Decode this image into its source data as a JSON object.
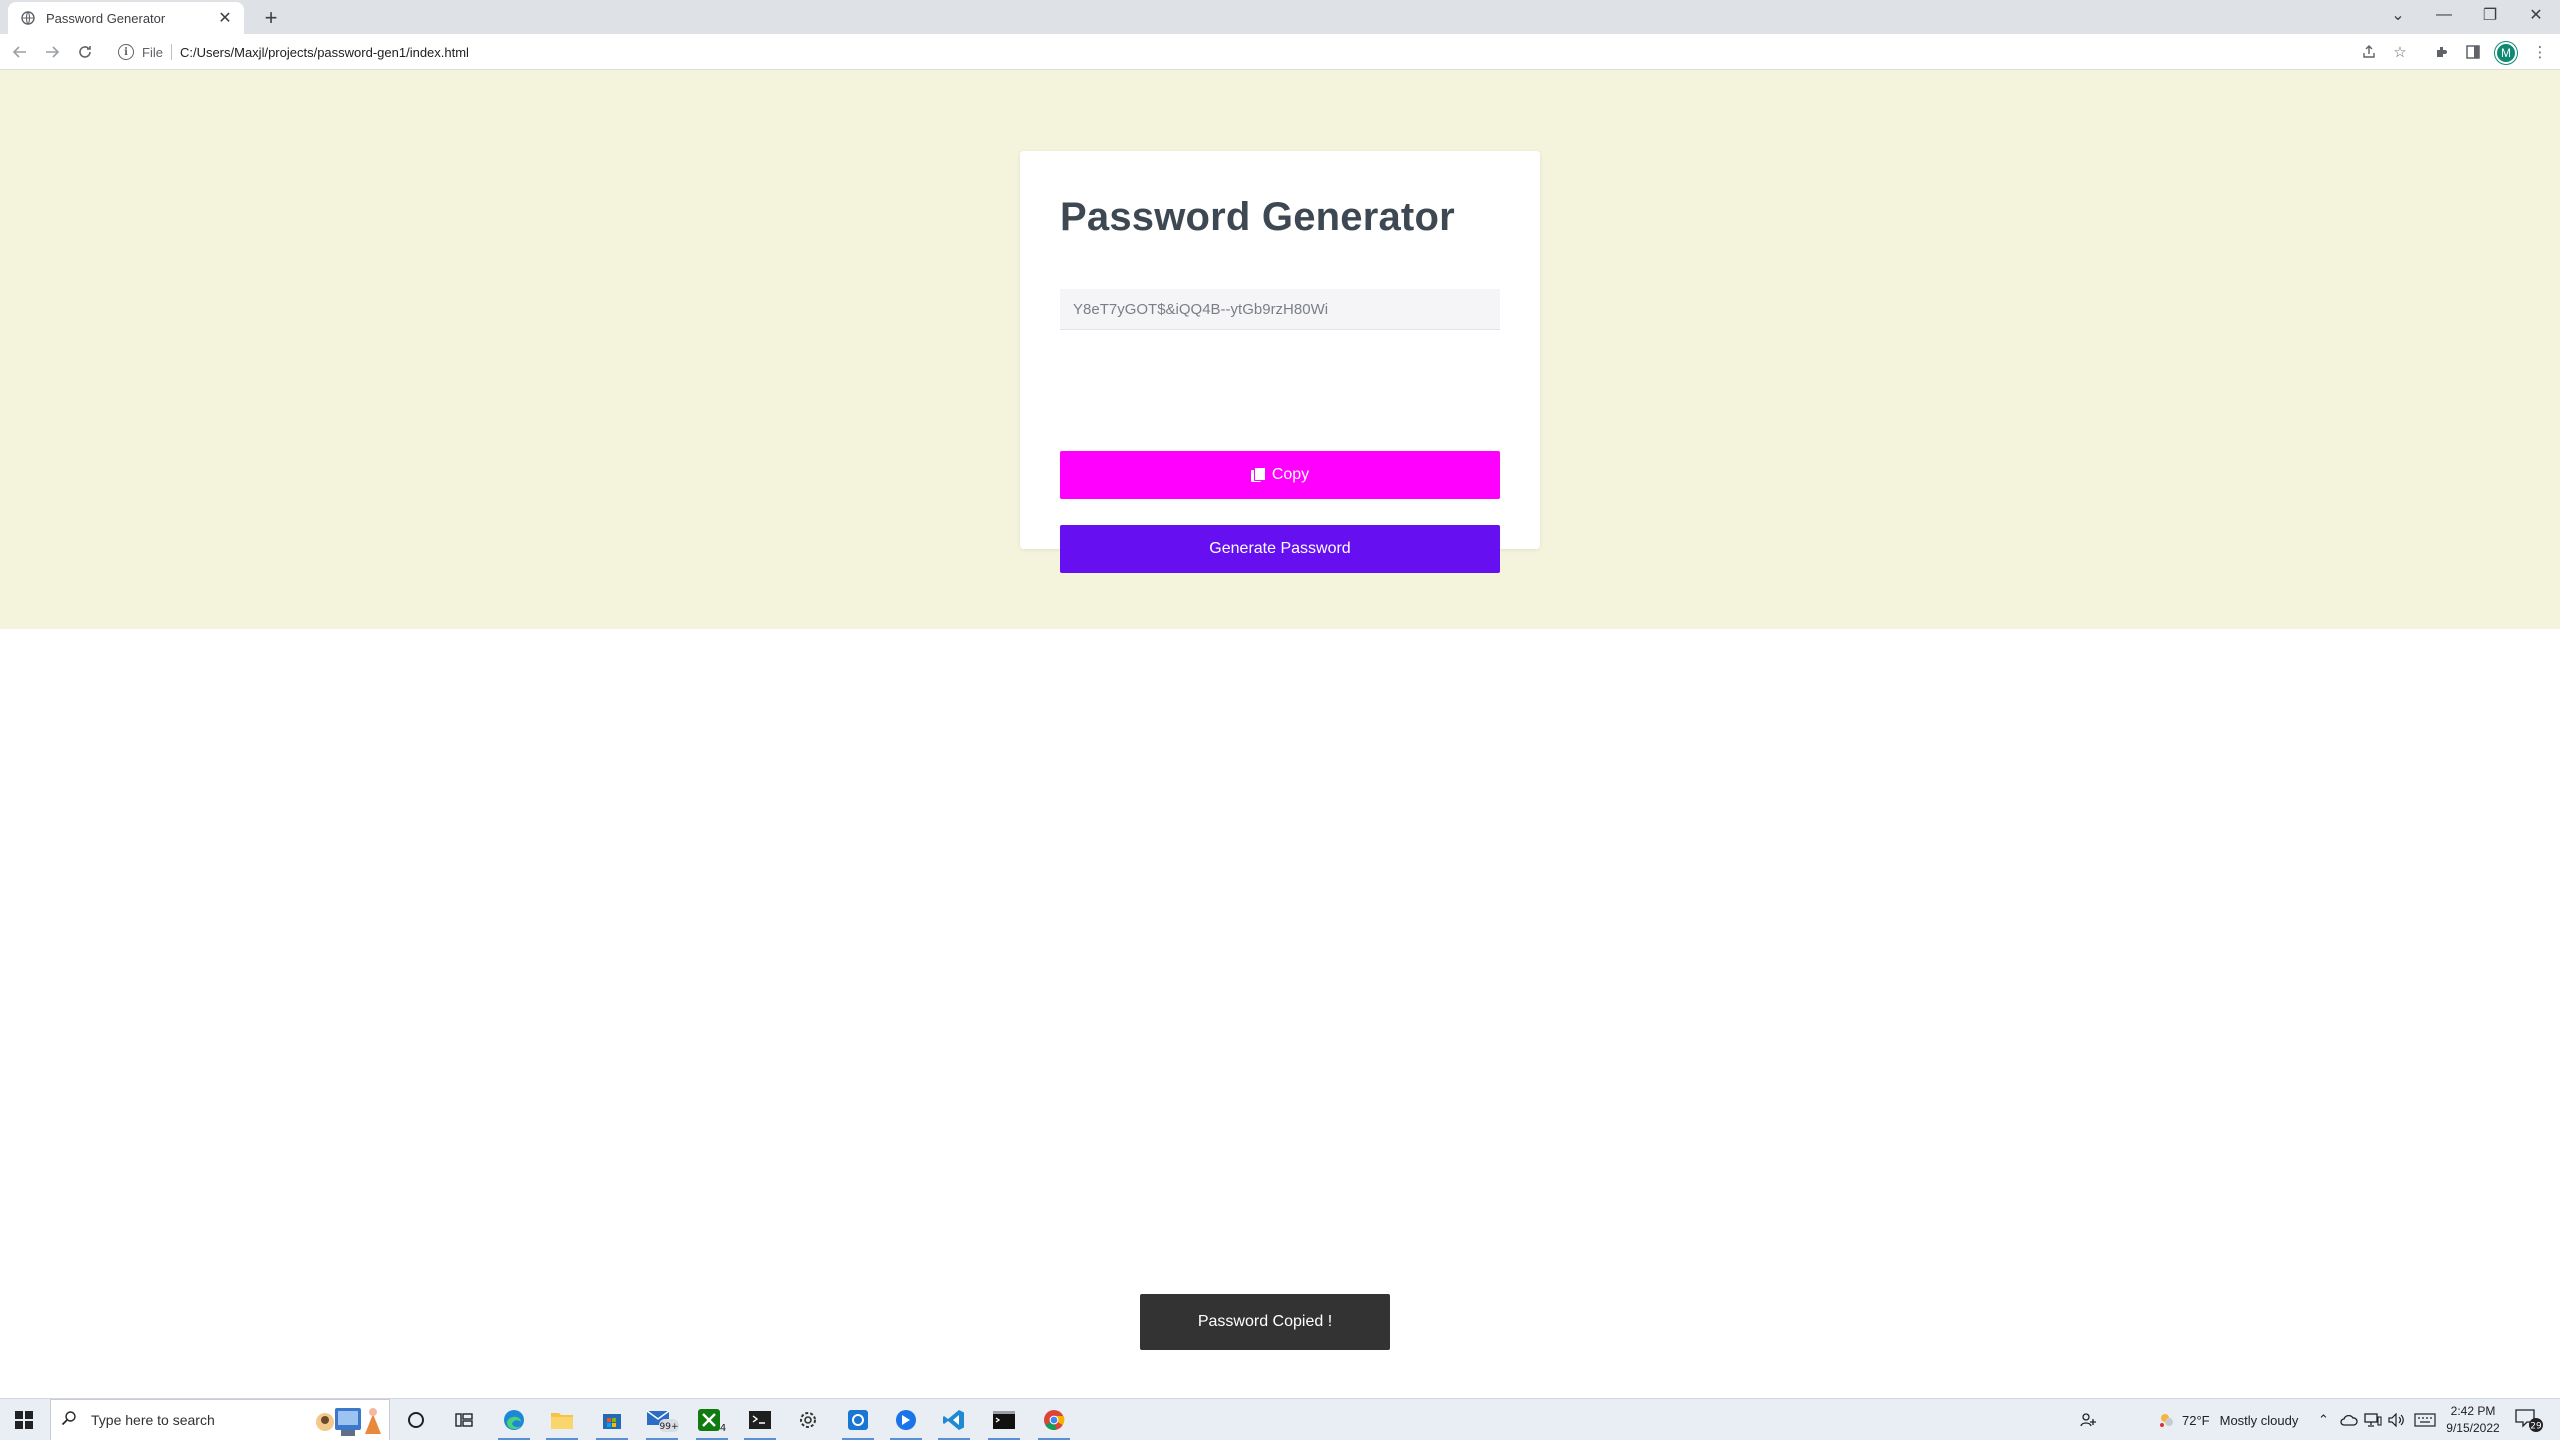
{
  "browser": {
    "tab_title": "Password Generator",
    "url_scheme": "File",
    "url": "C:/Users/Maxjl/projects/password-gen1/index.html",
    "profile_initial": "M"
  },
  "app": {
    "title": "Password Generator",
    "password_value": "Y8eT7yGOT$&iQQ4B--ytGb9rzH80Wi",
    "copy_label": "Copy",
    "generate_label": "Generate Password",
    "toast": "Password Copied !",
    "colors": {
      "hero_bg": "#f4f4dc",
      "copy_button": "#ff00ff",
      "generate_button": "#6610f2",
      "toast_bg": "#333333"
    }
  },
  "taskbar": {
    "search_placeholder": "Type here to search",
    "weather_temp": "72°F",
    "weather_desc": "Mostly cloudy",
    "time": "2:42 PM",
    "date": "9/15/2022",
    "mail_badge": "99+",
    "xbox_badge": "4",
    "notification_count": "29"
  }
}
